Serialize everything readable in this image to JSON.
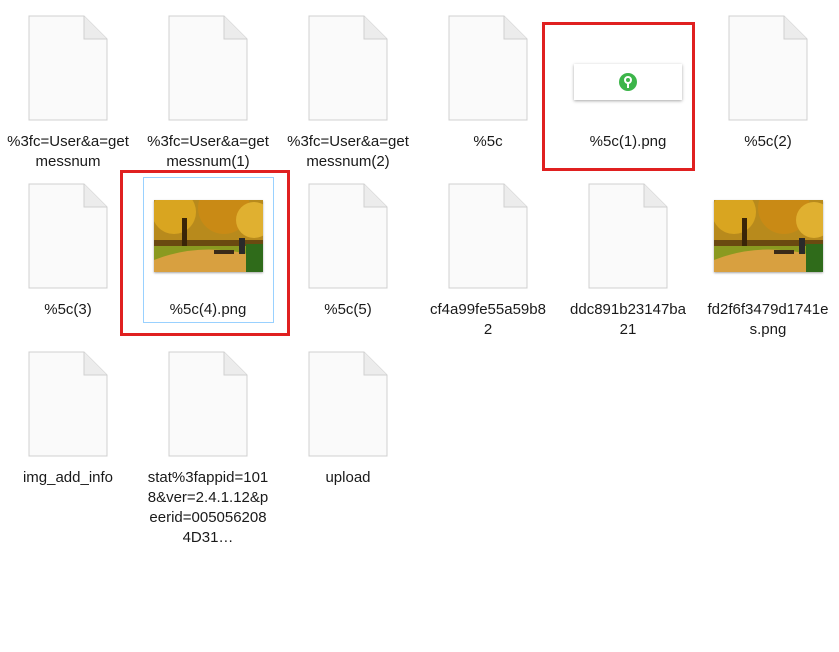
{
  "files": [
    {
      "label": "%3fc=User&a=getmessnum",
      "icon": "document-icon"
    },
    {
      "label": "%3fc=User&a=getmessnum(1)",
      "icon": "document-icon"
    },
    {
      "label": "%3fc=User&a=getmessnum(2)",
      "icon": "document-icon"
    },
    {
      "label": "%5c",
      "icon": "document-icon"
    },
    {
      "label": "%5c(1).png",
      "icon": "key-thumbnail-icon"
    },
    {
      "label": "%5c(2)",
      "icon": "document-icon"
    },
    {
      "label": "%5c(3)",
      "icon": "document-icon"
    },
    {
      "label": "%5c(4).png",
      "icon": "photo-thumbnail-icon"
    },
    {
      "label": "%5c(5)",
      "icon": "document-icon"
    },
    {
      "label": "cf4a99fe55a59b82",
      "icon": "document-icon"
    },
    {
      "label": "ddc891b23147ba21",
      "icon": "document-icon"
    },
    {
      "label": "fd2f6f3479d1741es.png",
      "icon": "photo-thumbnail-icon"
    },
    {
      "label": "img_add_info",
      "icon": "document-icon"
    },
    {
      "label": "stat%3fappid=1018&ver=2.4.1.12&peerid=0050562084D31…",
      "icon": "document-icon"
    },
    {
      "label": "upload",
      "icon": "document-icon"
    }
  ],
  "colors": {
    "highlight_border": "#e02020",
    "selection_border": "#99d1ff",
    "key_green": "#3cb54a"
  }
}
